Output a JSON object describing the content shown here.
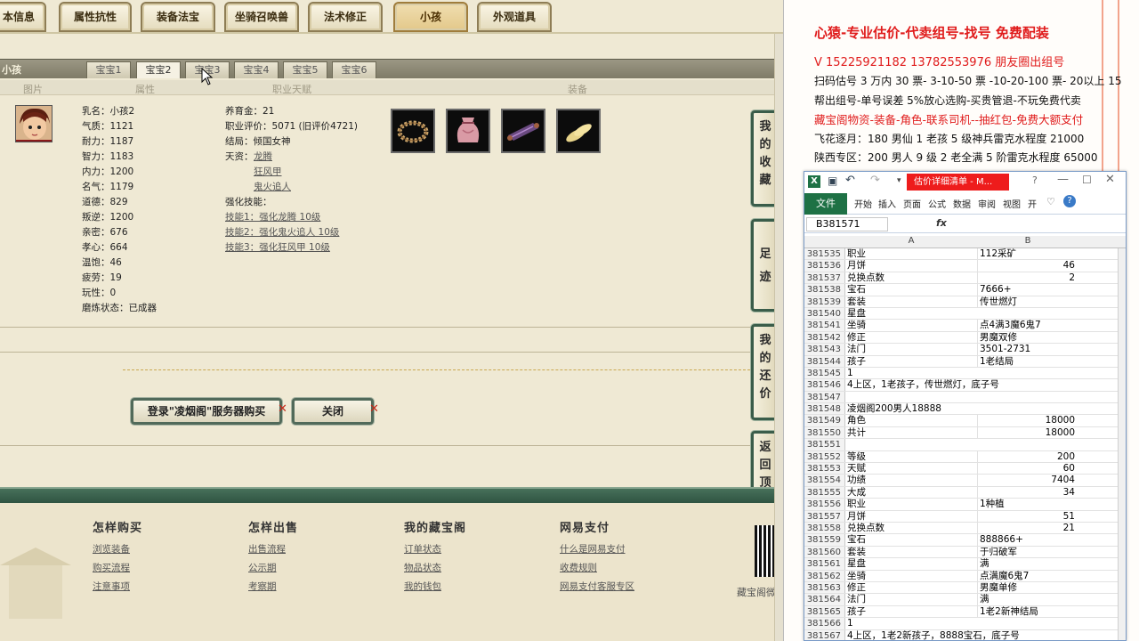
{
  "game": {
    "tabs": [
      {
        "label": "本信息"
      },
      {
        "label": "属性抗性"
      },
      {
        "label": "装备法宝"
      },
      {
        "label": "坐骑召唤兽"
      },
      {
        "label": "法术修正"
      },
      {
        "label": "小孩"
      },
      {
        "label": "外观道具"
      }
    ],
    "active_tab": "小孩",
    "section_title": "小孩",
    "sub_tabs": [
      "宝宝1",
      "宝宝2",
      "宝宝3",
      "宝宝4",
      "宝宝5",
      "宝宝6"
    ],
    "active_sub_tab": "宝宝2",
    "column_headers": [
      "图片",
      "属性",
      "职业天赋",
      "装备"
    ],
    "attributes": [
      "乳名：小孩2",
      "气质：1121",
      "耐力：1187",
      "智力：1183",
      "内力：1200",
      "名气：1179",
      "道德：829",
      "叛逆：1200",
      "亲密：676",
      "孝心：664",
      "温饱：46",
      "疲劳：19",
      "玩性：0",
      "磨炼状态：已成器"
    ],
    "career": {
      "raise": "养育金：21",
      "rating": "职业评价：5071 (旧评价4721)",
      "ending": "结局：倾国女神",
      "talent_label": "天资：",
      "talents": [
        "龙腾",
        "狂风甲",
        "鬼火追人"
      ],
      "skills_label": "强化技能：",
      "skills": [
        "技能1：强化龙腾 10级",
        "技能2：强化鬼火追人 10级",
        "技能3：强化狂风甲 10级"
      ]
    },
    "equipment_icons": [
      "wreath-icon",
      "pouch-icon",
      "scroll-icon",
      "slippers-icon"
    ],
    "buttons": {
      "buy": "登录\"凌烟阁\"服务器购买",
      "close": "关闭"
    },
    "side_buttons": [
      "我的收藏",
      "足迹",
      "我的还价",
      "返回顶部"
    ],
    "footer": {
      "columns": [
        {
          "title": "怎样购买",
          "links": [
            "浏览装备",
            "购买流程",
            "注意事项"
          ]
        },
        {
          "title": "怎样出售",
          "links": [
            "出售流程",
            "公示期",
            "考察期"
          ]
        },
        {
          "title": "我的藏宝阁",
          "links": [
            "订单状态",
            "物品状态",
            "我的钱包"
          ]
        },
        {
          "title": "网易支付",
          "links": [
            "什么是网易支付",
            "收费规则",
            "网易支付客服专区"
          ]
        }
      ],
      "copyright": "藏宝阁微"
    }
  },
  "notes": {
    "lines": [
      {
        "text": "心猿-专业估价-代卖组号-找号  免费配装",
        "style": "red",
        "size": 15
      },
      {
        "text": "V 15225921182   13782553976 朋友圈出组号",
        "style": "red",
        "size": 13
      },
      {
        "text": "扫码估号 3 万内 30 票- 3-10-50 票  -10-20-100 票- 20以上 15",
        "style": "blk",
        "size": 12
      },
      {
        "text": "帮出组号-单号误差 5%放心选购-买贵管退-不玩免费代卖",
        "style": "blk",
        "size": 12
      },
      {
        "text": "藏宝阁物资-装备-角色-联系司机--抽红包-免费大额支付",
        "style": "red",
        "size": 12.5
      },
      {
        "text": "飞花逐月：180 男仙 1 老孩 5 级神兵雷克水程度 21000",
        "style": "blk",
        "size": 12
      },
      {
        "text": "陕西专区：200 男人 9 级 2 老全满 5 阶雷克水程度 65000",
        "style": "blk",
        "size": 12
      }
    ]
  },
  "excel": {
    "title": "估价详细清单 - M...",
    "ribbon_file": "文件",
    "ribbon_tabs": [
      "开始",
      "插入",
      "页面",
      "公式",
      "数据",
      "审阅",
      "视图",
      "开"
    ],
    "name_box": "B381571",
    "fx": "fx",
    "col_a": "A",
    "col_b": "B",
    "rows": [
      {
        "n": "381535",
        "a": "职业",
        "b": "112采矿",
        "num": false
      },
      {
        "n": "381536",
        "a": "月饼",
        "b": "46",
        "num": true
      },
      {
        "n": "381537",
        "a": "兑换点数",
        "b": "2",
        "num": true
      },
      {
        "n": "381538",
        "a": "宝石",
        "b": "7666+",
        "num": false
      },
      {
        "n": "381539",
        "a": "套装",
        "b": "传世燃灯",
        "num": false
      },
      {
        "n": "381540",
        "a": "星盘",
        "b": "",
        "num": false
      },
      {
        "n": "381541",
        "a": "坐骑",
        "b": "点4满3魔6鬼7",
        "num": false
      },
      {
        "n": "381542",
        "a": "修正",
        "b": "男魔双修",
        "num": false
      },
      {
        "n": "381543",
        "a": "法门",
        "b": "3501-2731",
        "num": false
      },
      {
        "n": "381544",
        "a": "孩子",
        "b": "1老结局",
        "num": false
      },
      {
        "n": "381545",
        "a": "                                  1",
        "b": "",
        "num": false
      },
      {
        "n": "381546",
        "a": "4上区，1老孩子，传世燃灯，底子号",
        "b": "",
        "num": false
      },
      {
        "n": "381547",
        "a": "",
        "b": "",
        "num": false
      },
      {
        "n": "381548",
        "a": "凌烟阁200男人18888",
        "b": "",
        "num": false
      },
      {
        "n": "381549",
        "a": "角色",
        "b": "18000",
        "num": true
      },
      {
        "n": "381550",
        "a": "共计",
        "b": "18000",
        "num": true
      },
      {
        "n": "381551",
        "a": "",
        "b": "",
        "num": false
      },
      {
        "n": "381552",
        "a": "等级",
        "b": "200",
        "num": true
      },
      {
        "n": "381553",
        "a": "天赋",
        "b": "60",
        "num": true
      },
      {
        "n": "381554",
        "a": "功绩",
        "b": "7404",
        "num": true
      },
      {
        "n": "381555",
        "a": "大成",
        "b": "34",
        "num": true
      },
      {
        "n": "381556",
        "a": "职业",
        "b": "1种植",
        "num": false
      },
      {
        "n": "381557",
        "a": "月饼",
        "b": "51",
        "num": true
      },
      {
        "n": "381558",
        "a": "兑换点数",
        "b": "21",
        "num": true
      },
      {
        "n": "381559",
        "a": "宝石",
        "b": "888866+",
        "num": false
      },
      {
        "n": "381560",
        "a": "套装",
        "b": "于归破军",
        "num": false
      },
      {
        "n": "381561",
        "a": "星盘",
        "b": "满",
        "num": false
      },
      {
        "n": "381562",
        "a": "坐骑",
        "b": "点满魔6鬼7",
        "num": false
      },
      {
        "n": "381563",
        "a": "修正",
        "b": "男魔单修",
        "num": false
      },
      {
        "n": "381564",
        "a": "法门",
        "b": "满",
        "num": false
      },
      {
        "n": "381565",
        "a": "孩子",
        "b": "1老2新神结局",
        "num": false
      },
      {
        "n": "381566",
        "a": "                                  1",
        "b": "",
        "num": false
      },
      {
        "n": "381567",
        "a": "4上区，1老2新孩子，8888宝石，底子号",
        "b": "",
        "num": false
      }
    ]
  }
}
